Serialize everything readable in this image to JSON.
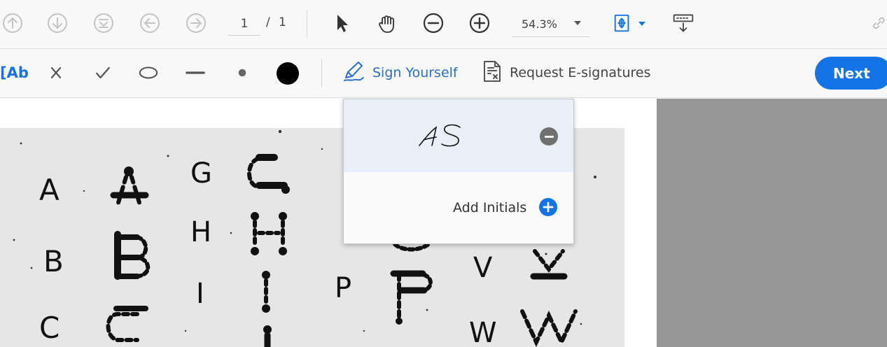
{
  "toolbar": {
    "page_current": "1",
    "page_separator": "/",
    "page_total": "1",
    "zoom_value": "54.3%",
    "icons": [
      "scroll-up-icon",
      "scroll-down-icon",
      "fit-page-icon",
      "previous-page-icon",
      "next-page-icon",
      "select-arrow-icon",
      "hand-tool-icon",
      "zoom-out-icon",
      "zoom-in-icon",
      "page-view-icon",
      "save-download-icon",
      "link-icon"
    ]
  },
  "fill_sign_toolbar": {
    "text_tool_label": "[Ab",
    "sign_yourself_label": "Sign Yourself",
    "request_esign_label": "Request E-signatures",
    "next_label": "Next",
    "tool_icons": [
      "cross-mark-icon",
      "check-mark-icon",
      "ellipse-icon",
      "line-icon",
      "dot-icon",
      "color-swatch-icon"
    ]
  },
  "sign_menu": {
    "initials_signature": "AS",
    "add_initials_label": "Add Initials"
  },
  "document": {
    "letters": [
      "A",
      "B",
      "C",
      "G",
      "H",
      "I",
      "P",
      "V",
      "W"
    ]
  },
  "colors": {
    "accent": "#1473e6",
    "sign_blue": "#2c6ecb",
    "toolbar_bg": "#f8f8f8",
    "menu_highlight": "#e8eff9",
    "gray_margin": "#979797",
    "color_swatch": "#000000"
  }
}
